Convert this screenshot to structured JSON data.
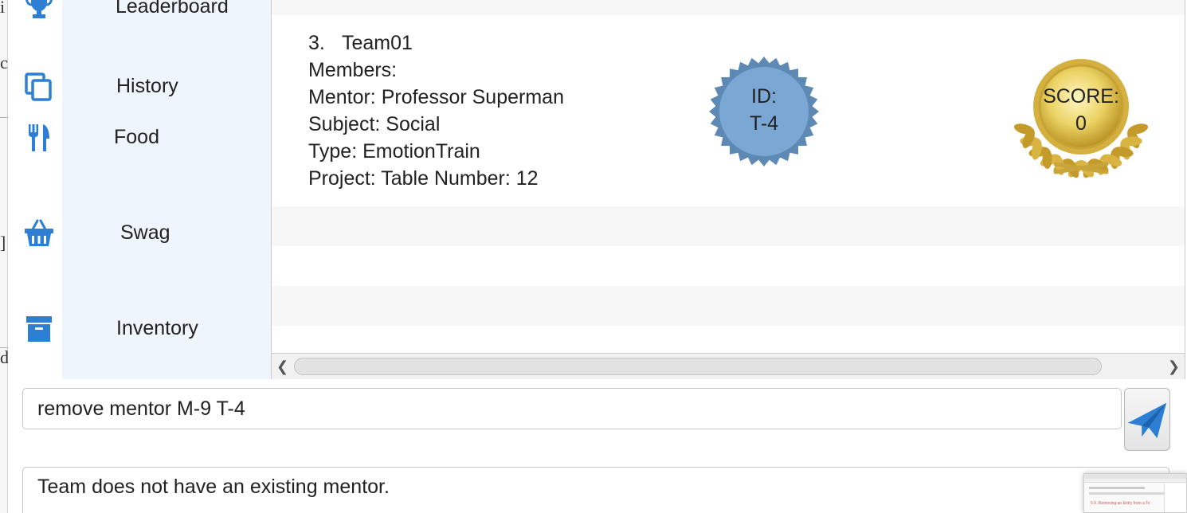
{
  "background_window": {
    "fragments": [
      "i",
      "c",
      "]",
      "d"
    ]
  },
  "sidebar": {
    "items": [
      {
        "label": "Leaderboard",
        "icon": "trophy-icon"
      },
      {
        "label": "History",
        "icon": "copy-icon"
      },
      {
        "label": "Food",
        "icon": "utensils-icon"
      },
      {
        "label": "Swag",
        "icon": "basket-icon"
      },
      {
        "label": "Inventory",
        "icon": "archive-box-icon"
      }
    ],
    "icon_color": "#2c7fd4",
    "background": "#eef5fd"
  },
  "team_card": {
    "index": "3.",
    "name": "Team01",
    "members_line": "Members:",
    "mentor_line": "Mentor: Professor Superman",
    "subject_line": "Subject: Social",
    "type_line": "Type: EmotionTrain",
    "project_line": "Project:  Table Number: 12",
    "id_badge": {
      "label": "ID:",
      "value": "T-4",
      "color": "#7aa7d4"
    },
    "score_badge": {
      "label": "SCORE:",
      "value": "0",
      "color": "#e8cf5a"
    }
  },
  "command_box": {
    "value": "remove mentor M-9 T-4",
    "send_icon": "paper-plane-icon",
    "send_icon_color": "#2c7fd4"
  },
  "result_box": {
    "message": "Team does not have an existing mentor."
  },
  "thumbnail": {
    "caption": "5.9. Removing an Entry from a Te"
  }
}
